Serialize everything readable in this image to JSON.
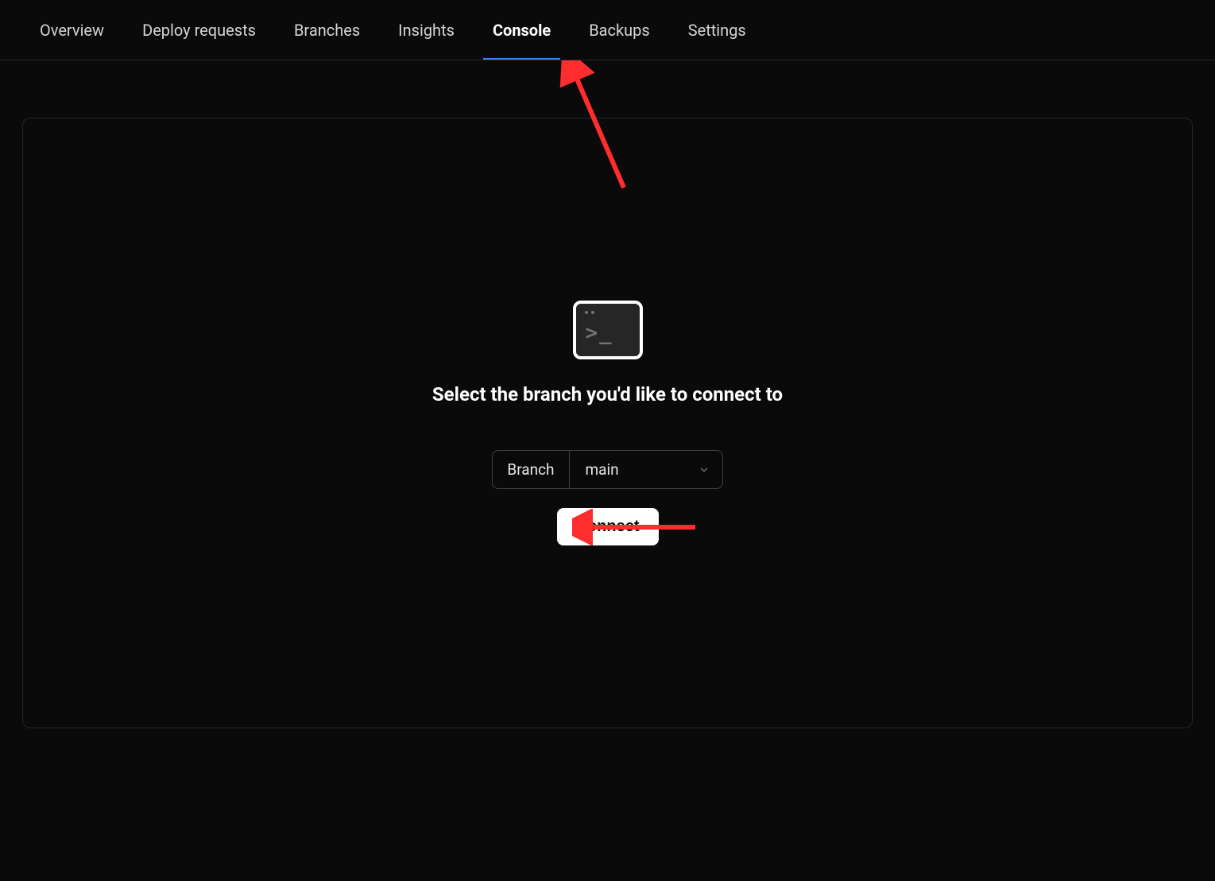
{
  "nav": {
    "tabs": [
      {
        "label": "Overview",
        "active": false
      },
      {
        "label": "Deploy requests",
        "active": false
      },
      {
        "label": "Branches",
        "active": false
      },
      {
        "label": "Insights",
        "active": false
      },
      {
        "label": "Console",
        "active": true
      },
      {
        "label": "Backups",
        "active": false
      },
      {
        "label": "Settings",
        "active": false
      }
    ]
  },
  "console": {
    "heading": "Select the branch you'd like to connect to",
    "branch_label": "Branch",
    "branch_value": "main",
    "connect_label": "Connect"
  },
  "annotations": {
    "arrow_color": "#ff2d2d"
  }
}
